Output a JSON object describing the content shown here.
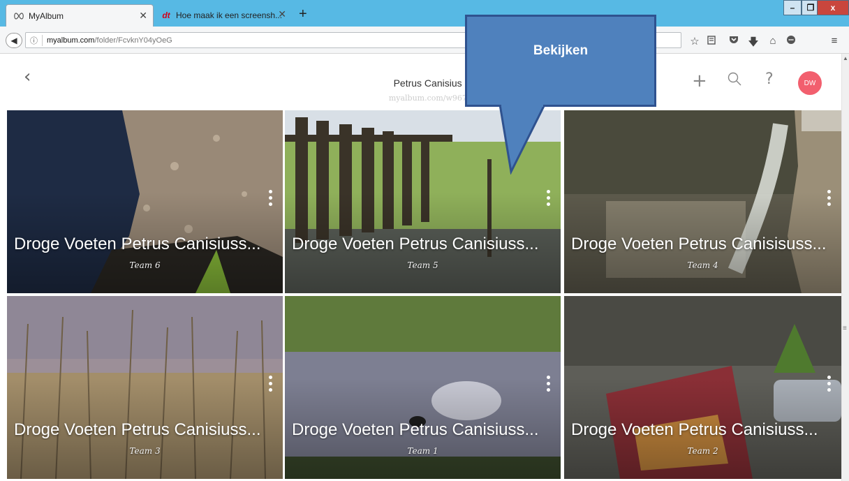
{
  "browser": {
    "tabs": [
      {
        "label": "MyAlbum",
        "active": true,
        "icon": "myalbum-favicon"
      },
      {
        "label": "Hoe maak ik een screensh...",
        "active": false,
        "icon": "dt-favicon"
      }
    ],
    "new_tab_label": "+",
    "window_controls": [
      "–",
      "❐",
      "x"
    ],
    "url_host": "myalbum.com",
    "url_path": "/folder/FcvknY04yOeG"
  },
  "album": {
    "title": "Petrus Canisius G",
    "url": "myalbum.com/w967yE",
    "avatar_initials": "DW"
  },
  "callout": {
    "label": "Bekijken",
    "fill": "#4f81bd"
  },
  "cards": [
    {
      "title": "Droge Voeten Petrus Canisiuss...",
      "subtitle": "Team 6"
    },
    {
      "title": "Droge Voeten Petrus Canisiuss...",
      "subtitle": "Team 5"
    },
    {
      "title": "Droge Voeten Petrus Canisisuss...",
      "subtitle": "Team 4"
    },
    {
      "title": "Droge Voeten Petrus Canisiuss...",
      "subtitle": "Team 3"
    },
    {
      "title": "Droge Voeten Petrus Canisiuss...",
      "subtitle": "Team 1"
    },
    {
      "title": "Droge Voeten Petrus Canisiuss...",
      "subtitle": "Team 2"
    }
  ]
}
